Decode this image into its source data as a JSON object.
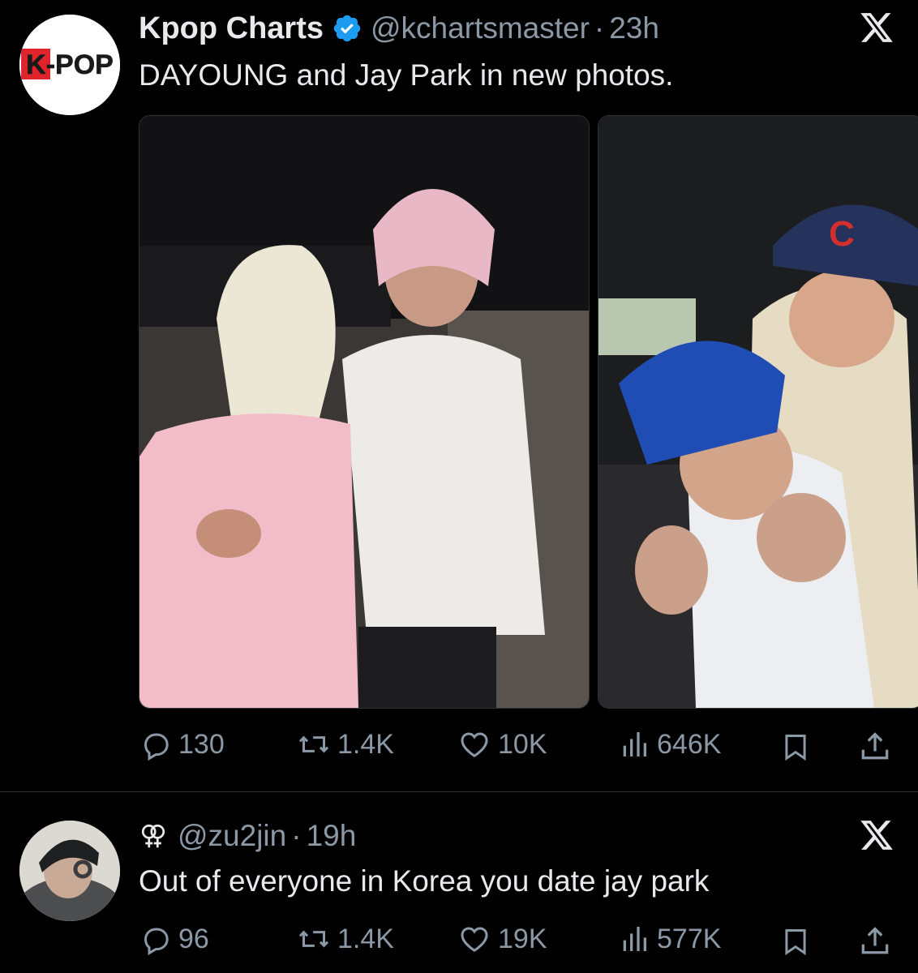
{
  "tweet": {
    "avatar_text": "K-POP",
    "author_name": "Kpop Charts",
    "handle": "@kchartsmaster",
    "separator": "·",
    "time": "23h",
    "text": "DAYOUNG and Jay Park in new photos.",
    "stats": {
      "replies": "130",
      "reposts": "1.4K",
      "likes": "10K",
      "views": "646K"
    }
  },
  "reply": {
    "handle": "@zu2jin",
    "separator": "·",
    "time": "19h",
    "text": "Out of everyone in Korea you date jay park",
    "stats": {
      "replies": "96",
      "reposts": "1.4K",
      "likes": "19K",
      "views": "577K"
    }
  },
  "colors": {
    "background": "#000000",
    "text_primary": "#e7e9ea",
    "text_secondary": "#8b98a5",
    "verified_blue": "#1d9bf0",
    "avatar_red": "#e0242b"
  }
}
